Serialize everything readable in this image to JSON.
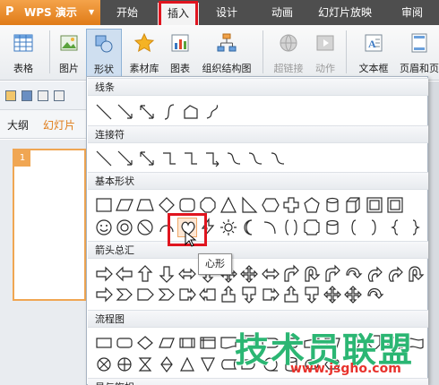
{
  "app": {
    "logo": "P",
    "name": "WPS 演示",
    "menu_arrow": "▼"
  },
  "tabs": [
    "开始",
    "插入",
    "设计",
    "动画",
    "幻灯片放映",
    "审阅"
  ],
  "active_tab": "插入",
  "ribbon": {
    "table": "表格",
    "picture": "图片",
    "shapes": "形状",
    "clip_library": "素材库",
    "chart": "图表",
    "org_chart": "组织结构图",
    "hyperlink": "超链接",
    "action": "动作",
    "textbox": "文本框",
    "header_footer": "页眉和页"
  },
  "left_pane": {
    "tab_outline": "大纲",
    "tab_slides": "幻灯片",
    "slide_number": "1"
  },
  "shape_panel": {
    "sections": {
      "lines": "线条",
      "connectors": "连接符",
      "basic": "基本形状",
      "block_arrows": "箭头总汇",
      "flowchart": "流程图",
      "stars": "星与旗帜"
    },
    "hovered_shape": "心形"
  },
  "watermark": {
    "main": "技术员联盟",
    "url": "www.jsgho.com"
  },
  "colors": {
    "accent": "#e07b17",
    "highlight": "#e0151f",
    "titlebar": "#4e4e4e"
  }
}
